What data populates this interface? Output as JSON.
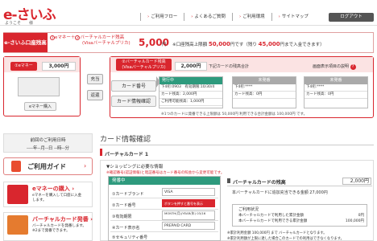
{
  "header": {
    "logo_text": "e-さいふ",
    "welcome": "ようこそ　　様",
    "nav": [
      "ご利用フロー",
      "よくあるご質問",
      "ご利用環境",
      "サイトマップ"
    ],
    "logout": "ログアウト"
  },
  "summary": {
    "label": "e-さいふ口座残高",
    "formula_em": "eマネー",
    "formula_plus": "＋",
    "formula_vc": "バーチャルカード残高",
    "formula_vc_sub": "(Visaバーチャルプリカ)",
    "total": "5,000",
    "yen": "円",
    "limit_text": "※口座残高上限額 50,000円 です（残り 45,000円 まで入金できます）",
    "limit_prefix": "※口座残高上限額 ",
    "limit_value": "50,000",
    "limit_mid": "円です（残り ",
    "remain_value": "45,000",
    "limit_suffix": "円まで入金できます）"
  },
  "emoney": {
    "label": "eマネー",
    "num": "①",
    "balance": "3,000円",
    "buy_button": "eマネー購入"
  },
  "transfer": {
    "charge": "充当",
    "refund": "返還"
  },
  "vcard": {
    "num": "②",
    "label_line1": "バーチャルカード残高",
    "label_line2": "(Visaバーチャルプリカ)",
    "balance": "2,000円",
    "note": "下記カードの残高合計",
    "help": "画面表示項目の説明",
    "help_icon": "?",
    "btn_number": "カード番号",
    "btn_info": "カード情報確認",
    "cards": [
      {
        "status": "発行中",
        "row1": "下4桁:0903　有効期限:10/30/4",
        "row2": "カード残高：2,000円",
        "row3": "ご利用可能残高：1,000円"
      },
      {
        "status": "未発番",
        "row1": "下4桁:****",
        "row2": "カード残高：0円",
        "row3": ""
      },
      {
        "status": "未発番",
        "row1": "下4桁:****",
        "row2": "カード残高：0円",
        "row3": ""
      }
    ],
    "footnote": "※1つのカードに発番できる上限額は 50,000円 利用できる合計金額は 100,000円 です。"
  },
  "sidebar": {
    "last_use_label": "前回のご利用日時",
    "last_use_value": "----年--月--日 --時--分",
    "guide": "ご利用ガイド",
    "guide_arrow": "›",
    "box1_title": "eマネーの購入",
    "box1_arrow": "›",
    "box1_desc": [
      "eマネーを購入して口座に入金",
      "します。"
    ],
    "box2_title": "バーチャルカード発番",
    "box2_arrow": "›",
    "box2_desc": [
      "バーチャルカードを発番します。",
      "※2まで発番できます。"
    ]
  },
  "main": {
    "title": "カード情報確認",
    "subtitle": "バーチャルカード 1",
    "info_heading": "▼ショッピングに必要な情報",
    "notice": "※確認番号(認証情報)と暗証番号はカード番号の照会から変更可能です。",
    "form_head": "発番中",
    "form": [
      {
        "label": "①カードブランド",
        "value": "VISA"
      },
      {
        "label": "②カード番号",
        "value": "ボタンを押すと番号を表示"
      },
      {
        "label": "③有効期限",
        "value": "MONTH(月)/YEAR(年)  03/16"
      },
      {
        "label": "④カード表示名",
        "value": "PREPAID CARD"
      },
      {
        "label": "⑤セキュリティ番号",
        "value": ""
      }
    ],
    "balance_head": "バーチャルカードの残高",
    "balance_value": "2,000",
    "balance_unit": "円",
    "balance_note": "本バーチャルカードに追加充当できる金額 27,000円",
    "limit_label": "ご利用状況",
    "limit_rows": [
      {
        "label": "本バーチャルカードで利用した累計金額",
        "value": "0円"
      },
      {
        "label": "本バーチャルカードで利用できる累計金額",
        "value": "100,000円"
      }
    ],
    "footnote1": "※累計利用金額 100,000円 まで バーチャルカードとなります。",
    "footnote2": "※累計利用額が上限に達した場合このカードでの利用はできなくなります。"
  },
  "colors": {
    "brand_red": "#d9262e",
    "issued_green": "#2e9a7d"
  }
}
